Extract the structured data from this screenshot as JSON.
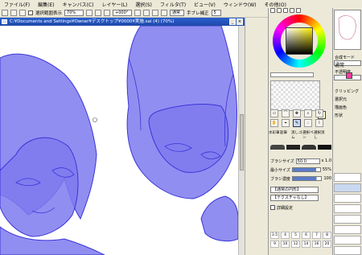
{
  "menu": [
    "ファイル(F)",
    "編集(E)",
    "キャンバス(C)",
    "レイヤー(L)",
    "選択(S)",
    "フィルタ(T)",
    "ビュー(V)",
    "ウィンドウ(W)",
    "その他(O)"
  ],
  "toolbar": {
    "selection_label": "選択範囲表示",
    "zoom_value": "70%",
    "rotation_value": "+000°",
    "mode_value": "通常",
    "stabilizer_label": "手ブレ補正",
    "stabilizer_value": "5"
  },
  "document": {
    "title": "C:¥Documents and Settings¥Owner¥デスクトップ¥0000¥実施.sai (4) (70%)"
  },
  "tools": [
    "選択",
    "なげなわ",
    "移動",
    "ズーム",
    "回転",
    "手のひら",
    "スポイト",
    "ペン",
    "エアブラシ",
    "筆",
    "水彩筆",
    "鉛筆",
    "消しゴム",
    "選択ペン",
    "選択消し"
  ],
  "brush_props": {
    "size_label": "ブラシサイズ",
    "size_value": "50.0",
    "size_multiplier": "x 1.0",
    "min_label": "最小サイズ",
    "min_value": "55%",
    "density_label": "ブラシ濃度",
    "density_value": "100",
    "shape_select": "【通常の円形】",
    "texture_select": "【テクスチャなし】",
    "detail_label": "詳細設定"
  },
  "brush_presets": [
    "3.5",
    "4",
    "5",
    "6",
    "7",
    "8",
    "9",
    "10",
    "12",
    "14",
    "16",
    "20"
  ],
  "layer_panel": {
    "mode_label": "合成モード",
    "mode_value": "通常",
    "opacity_label": "不透明度",
    "clip_label": "クリッピング",
    "select_source_label": "選択元",
    "protect_label": "描画色",
    "shape_label": "形状"
  },
  "colors": {
    "line_art": "#3a35d8",
    "line_fill": "#7e7aee",
    "title_bar": "#2a5fcf",
    "panel_bg": "#ece9d8"
  }
}
